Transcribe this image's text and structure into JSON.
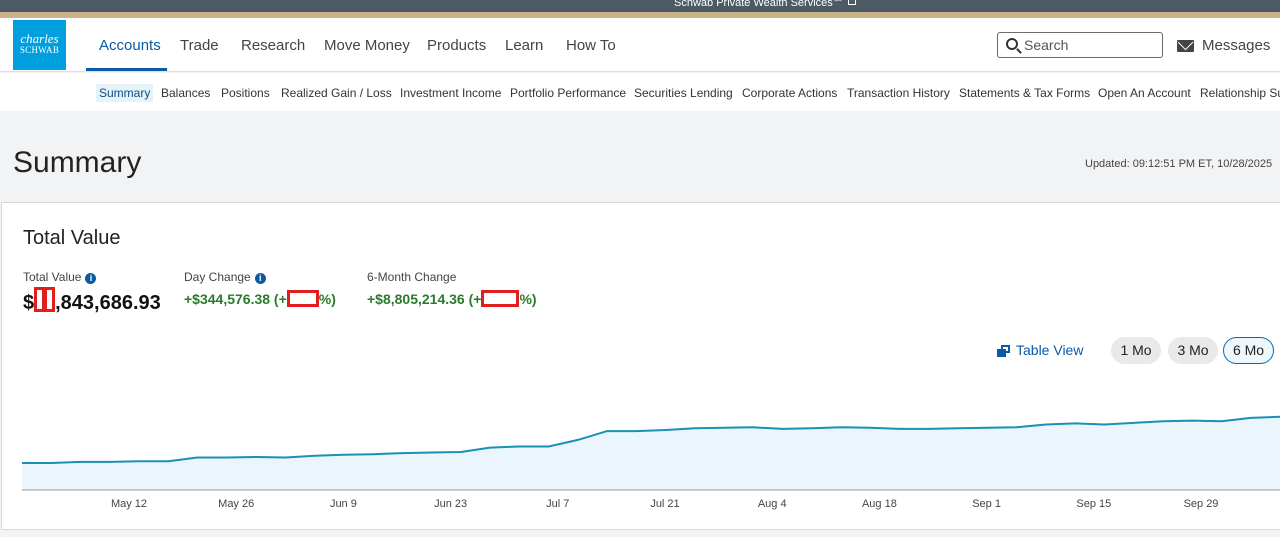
{
  "banner": {
    "text": "Schwab Private Wealth Services℠"
  },
  "brand": {
    "line1": "charles",
    "line2": "SCHWAB"
  },
  "nav": [
    "Accounts",
    "Trade",
    "Research",
    "Move Money",
    "Products",
    "Learn",
    "How To"
  ],
  "search": {
    "placeholder": "Search"
  },
  "messages": {
    "label": "Messages"
  },
  "subnav": [
    "Summary",
    "Balances",
    "Positions",
    "Realized Gain / Loss",
    "Investment Income",
    "Portfolio Performance",
    "Securities Lending",
    "Corporate Actions",
    "Transaction History",
    "Statements & Tax Forms",
    "Open An Account",
    "Relationship Su"
  ],
  "page": {
    "title": "Summary",
    "updated": "Updated: 09:12:51 PM ET, 10/28/2025"
  },
  "total_value_card": {
    "title": "Total Value",
    "total_value": {
      "label": "Total Value",
      "prefix": "$",
      "suffix": ",843,686.93"
    },
    "day_change": {
      "label": "Day Change",
      "prefix": "+$344,576.38 (+",
      "suffix": "%)"
    },
    "six_month_change": {
      "label": "6-Month Change",
      "prefix": "+$8,805,214.36 (+",
      "suffix": "%)"
    },
    "table_view": "Table View",
    "ranges": [
      "1 Mo",
      "3 Mo",
      "6 Mo"
    ],
    "selected_range": "6 Mo"
  },
  "colors": {
    "accent": "#0a5aa5",
    "gain": "#2c7a2c",
    "line": "#1a8fb8",
    "area": "#eaf6fb",
    "redaction": "#e01e1e"
  },
  "chart_data": {
    "type": "area",
    "x_tick_labels": [
      "May 12",
      "May 26",
      "Jun 9",
      "Jun 23",
      "Jul 7",
      "Jul 21",
      "Aug 4",
      "Aug 18",
      "Sep 1",
      "Sep 15",
      "Sep 29"
    ],
    "values_relative": [
      0.0,
      0.0,
      0.02,
      0.02,
      0.03,
      0.03,
      0.1,
      0.1,
      0.11,
      0.1,
      0.13,
      0.15,
      0.16,
      0.18,
      0.19,
      0.2,
      0.28,
      0.3,
      0.3,
      0.42,
      0.58,
      0.58,
      0.6,
      0.63,
      0.64,
      0.65,
      0.62,
      0.63,
      0.65,
      0.64,
      0.62,
      0.62,
      0.63,
      0.64,
      0.65,
      0.7,
      0.72,
      0.7,
      0.73,
      0.76,
      0.77,
      0.76,
      0.82,
      0.84
    ]
  }
}
